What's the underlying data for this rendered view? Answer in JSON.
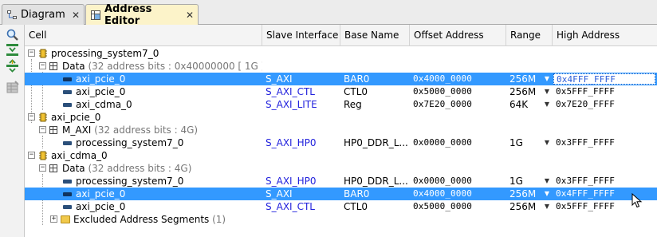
{
  "tabs": [
    {
      "label": "Diagram",
      "icon": "diagram-icon",
      "close": "✕"
    },
    {
      "label": "Address Editor",
      "icon": "address-editor-icon",
      "close": "✕"
    }
  ],
  "toolbar": [
    {
      "icon": "search-icon"
    },
    {
      "icon": "collapse-all-icon"
    },
    {
      "icon": "expand-all-icon"
    },
    {
      "icon": "auto-assign-icon"
    }
  ],
  "columns": {
    "cell": "Cell",
    "slave_interface": "Slave Interface",
    "base_name": "Base Name",
    "offset_address": "Offset Address",
    "range": "Range",
    "high_address": "High Address"
  },
  "rows": [
    {
      "kind": "processor",
      "label": "processing_system7_0"
    },
    {
      "kind": "space",
      "label": "Data",
      "detail": "(32 address bits : 0x40000000 [ 1G ])"
    },
    {
      "kind": "segment",
      "label": "axi_pcie_0",
      "slave": "S_AXI",
      "base": "BAR0",
      "offset": "0x4000_0000",
      "range": "256M",
      "high": "0x4FFF_FFFF",
      "selected": true,
      "editing": true
    },
    {
      "kind": "segment",
      "label": "axi_pcie_0",
      "slave": "S_AXI_CTL",
      "base": "CTL0",
      "offset": "0x5000_0000",
      "range": "256M",
      "high": "0x5FFF_FFFF"
    },
    {
      "kind": "segment",
      "label": "axi_cdma_0",
      "slave": "S_AXI_LITE",
      "base": "Reg",
      "offset": "0x7E20_0000",
      "range": "64K",
      "high": "0x7E20_FFFF"
    },
    {
      "kind": "processor",
      "label": "axi_pcie_0"
    },
    {
      "kind": "space",
      "label": "M_AXI",
      "detail": "(32 address bits : 4G)"
    },
    {
      "kind": "segment",
      "label": "processing_system7_0",
      "slave": "S_AXI_HP0",
      "base": "HP0_DDR_L...",
      "offset": "0x0000_0000",
      "range": "1G",
      "high": "0x3FFF_FFFF"
    },
    {
      "kind": "processor",
      "label": "axi_cdma_0"
    },
    {
      "kind": "space",
      "label": "Data",
      "detail": "(32 address bits : 4G)"
    },
    {
      "kind": "segment",
      "label": "processing_system7_0",
      "slave": "S_AXI_HP0",
      "base": "HP0_DDR_L...",
      "offset": "0x0000_0000",
      "range": "1G",
      "high": "0x3FFF_FFFF"
    },
    {
      "kind": "segment",
      "label": "axi_pcie_0",
      "slave": "S_AXI",
      "base": "BAR0",
      "offset": "0x4000_0000",
      "range": "256M",
      "high": "0x4FFF_FFFF",
      "selected": true
    },
    {
      "kind": "segment",
      "label": "axi_pcie_0",
      "slave": "S_AXI_CTL",
      "base": "CTL0",
      "offset": "0x5000_0000",
      "range": "256M",
      "high": "0x5FFF_FFFF"
    },
    {
      "kind": "excluded",
      "label": "Excluded Address Segments",
      "detail": "(1)"
    }
  ],
  "colors": {
    "selection": "#3399ff",
    "active_tab": "#fcf3c9",
    "slave_link": "#2222dd"
  }
}
